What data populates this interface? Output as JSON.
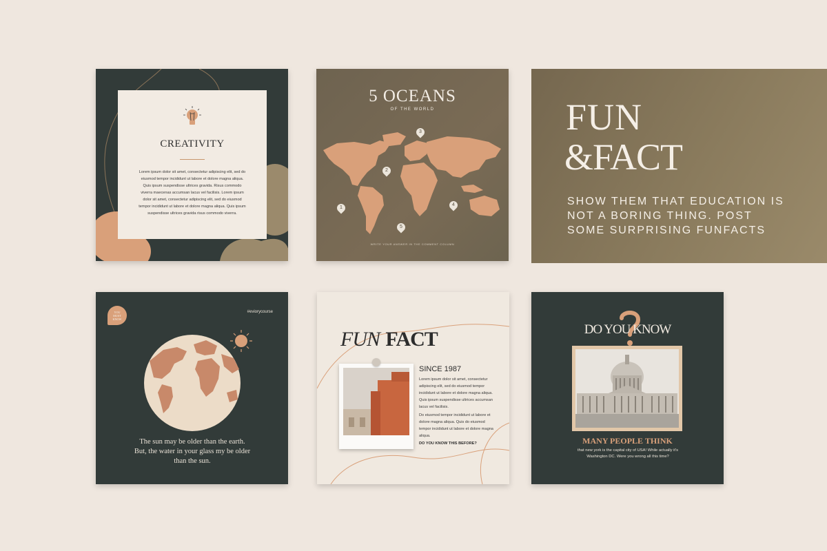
{
  "creativity": {
    "title": "CREATIVITY",
    "body": "Lorem ipsum dolor sit amet, consectetur adipiscing elit, sed do eiusmod tempor incididunt ut labore et dolore magna aliqua. Quis ipsum suspendisse ultrices gravida. Risus commodo viverra maecenas accumsan lacus vel facilisis. Lorem ipsum dolor sit amet, consectetur adipiscing elit, sed do eiusmod tempor incididunt ut labore et dolore magna aliqua. Quis ipsum suspendisse ultrices gravida risus commodo viverra.",
    "icon": "lightbulb-icon"
  },
  "oceans": {
    "title": "5 OCEANS",
    "subtitle": "OF THE WORLD",
    "pins": [
      "1",
      "2",
      "3",
      "4",
      "5"
    ],
    "footer": "WRITE YOUR ANSWER IN THE COMMENT COLUMN"
  },
  "funfact_banner": {
    "line1": "FUN",
    "line2": "&FACT",
    "text": "SHOW THEM THAT EDUCATION IS NOT A BORING THING. POST SOME SURPRISING FUNFACTS"
  },
  "sun_card": {
    "badge": "YOU MUST KNOW",
    "hashtag": "#eviorycourse",
    "text": "The sun may be older than the earth. But, the water in your glass my be older than the sun."
  },
  "funfact_card": {
    "title_italic": "FUN",
    "title_bold": "FACT",
    "since": "SINCE 1987",
    "p1": "Lorem ipsum dolor sit amet, consectetur adipiscing elit, sed do eiusmod tempor incididunt ut labore et dolore magna aliqua. Quis ipsum suspendisse ultrices accumsan lacus vel facilisis.",
    "p2": "Do eiusmod tempor incididunt ut labore et dolore magna aliqua. Quis do eiusmod tempor incididunt ut labore et dolore magna aliqua.",
    "question": "DO YOU KNOW THIS BEFORE?"
  },
  "doyouknow": {
    "title": "DO YOU KNOW",
    "heading": "MANY PEOPLE THINK",
    "text": "that new york is the capital city of USA! While actually it's Washington DC. Were you wrong all this time?"
  },
  "colors": {
    "background": "#efe7df",
    "dark_green": "#323b39",
    "terracotta": "#d9a07a",
    "olive_brown": "#7a6b55",
    "cream": "#f0e9e0"
  }
}
